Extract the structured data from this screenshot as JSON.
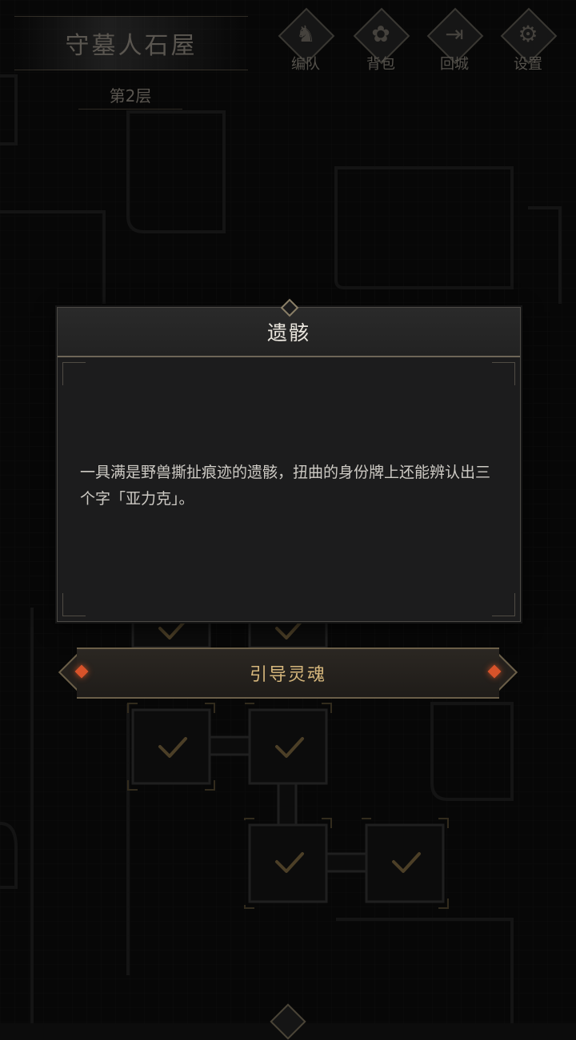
{
  "location": {
    "name": "守墓人石屋",
    "floor": "第2层"
  },
  "hud": [
    {
      "id": "team",
      "label": "编队",
      "icon": "horned-helmet-icon"
    },
    {
      "id": "bag",
      "label": "背包",
      "icon": "bag-icon"
    },
    {
      "id": "return",
      "label": "回城",
      "icon": "door-exit-icon"
    },
    {
      "id": "settings",
      "label": "设置",
      "icon": "gear-icon"
    }
  ],
  "dialog": {
    "title": "遗骸",
    "body": "一具满是野兽撕扯痕迹的遗骸，扭曲的身份牌上还能辨认出三个字「亚力克」。"
  },
  "action": {
    "label": "引导灵魂"
  },
  "colors": {
    "accent_gold": "#d6b77c",
    "gem_orange": "#d8532a",
    "check_gold": "#8a7448"
  },
  "map": {
    "cleared_rooms_with_checkmarks": 8
  }
}
